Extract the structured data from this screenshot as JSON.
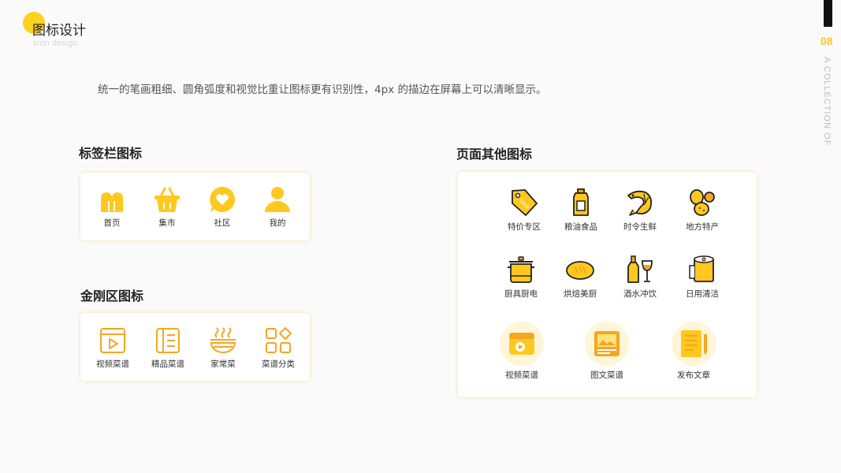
{
  "header": {
    "title": "图标设计",
    "subtitle": "Icon design",
    "page_number": "08",
    "side_text": "A COLLECTION OF"
  },
  "description": "统一的笔画粗细、圆角弧度和视觉比重让图标更有识别性，4px 的描边在屏幕上可以清晰显示。",
  "colors": {
    "accent": "#ffc81e",
    "accent_light": "#ffe27a",
    "outline": "#222222",
    "icon_orange": "#f5a623"
  },
  "tabbar": {
    "title": "标签栏图标",
    "items": [
      {
        "label": "首页",
        "icon": "home-icon"
      },
      {
        "label": "集市",
        "icon": "basket-icon"
      },
      {
        "label": "社区",
        "icon": "heart-bubble-icon"
      },
      {
        "label": "我的",
        "icon": "user-icon"
      }
    ]
  },
  "kingkong": {
    "title": "金刚区图标",
    "items": [
      {
        "label": "视频菜谱",
        "icon": "video-icon"
      },
      {
        "label": "精品菜谱",
        "icon": "book-icon"
      },
      {
        "label": "家常菜",
        "icon": "bowl-icon"
      },
      {
        "label": "菜谱分类",
        "icon": "category-icon"
      }
    ]
  },
  "other": {
    "title": "页面其他图标",
    "row1": [
      {
        "label": "特价专区",
        "icon": "sale-tag-icon"
      },
      {
        "label": "粮油食品",
        "icon": "oil-bottle-icon"
      },
      {
        "label": "时令生鲜",
        "icon": "shrimp-icon"
      },
      {
        "label": "地方特产",
        "icon": "potato-icon"
      }
    ],
    "row2": [
      {
        "label": "厨具厨电",
        "icon": "pot-icon"
      },
      {
        "label": "烘焙美厨",
        "icon": "bread-icon"
      },
      {
        "label": "酒水冲饮",
        "icon": "wine-icon"
      },
      {
        "label": "日用清洁",
        "icon": "tissue-icon"
      }
    ],
    "row3": [
      {
        "label": "视频菜谱",
        "icon": "video-recipe-icon"
      },
      {
        "label": "图文菜谱",
        "icon": "image-recipe-icon"
      },
      {
        "label": "发布文章",
        "icon": "publish-article-icon"
      }
    ]
  }
}
